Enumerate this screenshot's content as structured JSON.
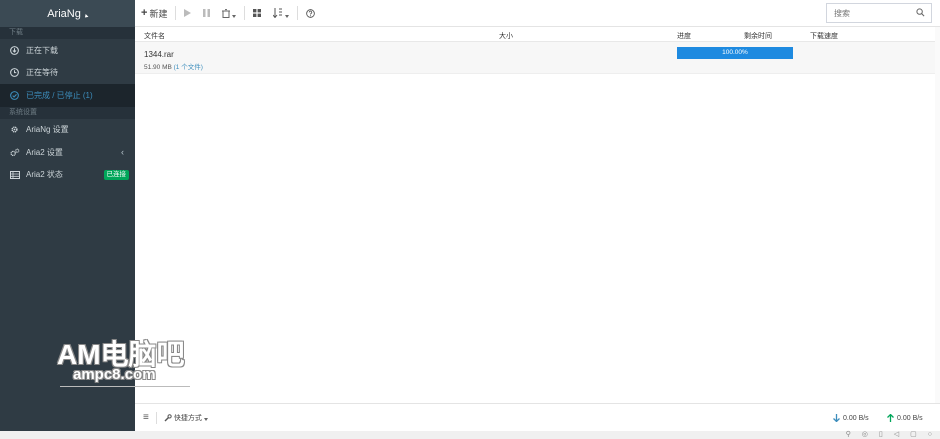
{
  "sidebar": {
    "brand": "AriaNg",
    "section_download": "下载",
    "items_download": [
      {
        "label": "正在下载",
        "icon": "download-circle-icon"
      },
      {
        "label": "正在等待",
        "icon": "clock-icon"
      },
      {
        "label": "已完成 / 已停止 (1)",
        "icon": "check-circle-icon"
      }
    ],
    "section_settings": "系统设置",
    "items_settings": [
      {
        "label": "AriaNg 设置",
        "icon": "gear-icon"
      },
      {
        "label": "Aria2 设置",
        "icon": "gears-icon"
      },
      {
        "label": "Aria2 状态",
        "icon": "server-icon",
        "badge": "已连接"
      }
    ]
  },
  "toolbar": {
    "new_label": "新建",
    "search_placeholder": "搜索"
  },
  "table": {
    "headers": {
      "name": "文件名",
      "size": "大小",
      "progress": "进度",
      "remaining": "剩余时间",
      "speed": "下载速度"
    },
    "rows": [
      {
        "name": "1344.rar",
        "size": "51.90 MB",
        "file_count": "(1 个文件)",
        "progress_text": "100.00%",
        "progress_value": 100
      }
    ]
  },
  "footer": {
    "shortcut_label": "快捷方式",
    "download_speed": "0.00 B/s",
    "upload_speed": "0.00 B/s"
  },
  "watermark": {
    "line1": "AM电脑吧",
    "line2": "ampc8.com"
  },
  "colors": {
    "sidebar_bg": "#2f3b44",
    "accent": "#3c8dbc",
    "badge": "#00a65a"
  }
}
